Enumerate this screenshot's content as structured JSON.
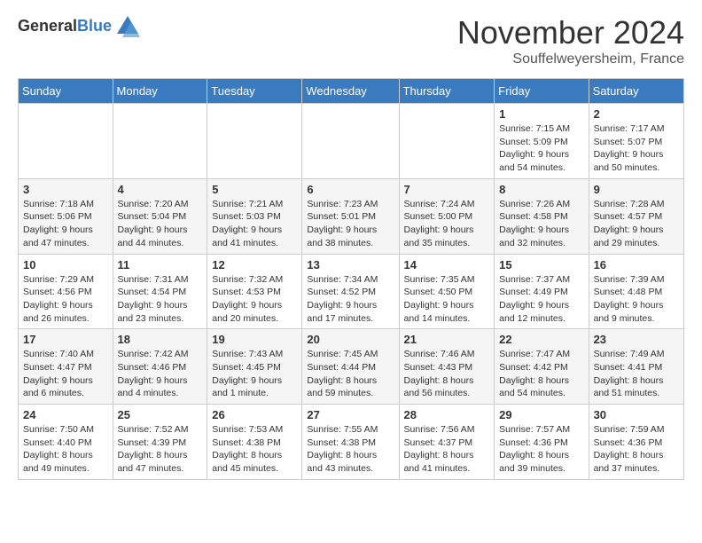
{
  "header": {
    "logo_general": "General",
    "logo_blue": "Blue",
    "title": "November 2024",
    "subtitle": "Souffelweyersheim, France"
  },
  "days_of_week": [
    "Sunday",
    "Monday",
    "Tuesday",
    "Wednesday",
    "Thursday",
    "Friday",
    "Saturday"
  ],
  "weeks": [
    [
      {
        "day": "",
        "info": ""
      },
      {
        "day": "",
        "info": ""
      },
      {
        "day": "",
        "info": ""
      },
      {
        "day": "",
        "info": ""
      },
      {
        "day": "",
        "info": ""
      },
      {
        "day": "1",
        "info": "Sunrise: 7:15 AM\nSunset: 5:09 PM\nDaylight: 9 hours and 54 minutes."
      },
      {
        "day": "2",
        "info": "Sunrise: 7:17 AM\nSunset: 5:07 PM\nDaylight: 9 hours and 50 minutes."
      }
    ],
    [
      {
        "day": "3",
        "info": "Sunrise: 7:18 AM\nSunset: 5:06 PM\nDaylight: 9 hours and 47 minutes."
      },
      {
        "day": "4",
        "info": "Sunrise: 7:20 AM\nSunset: 5:04 PM\nDaylight: 9 hours and 44 minutes."
      },
      {
        "day": "5",
        "info": "Sunrise: 7:21 AM\nSunset: 5:03 PM\nDaylight: 9 hours and 41 minutes."
      },
      {
        "day": "6",
        "info": "Sunrise: 7:23 AM\nSunset: 5:01 PM\nDaylight: 9 hours and 38 minutes."
      },
      {
        "day": "7",
        "info": "Sunrise: 7:24 AM\nSunset: 5:00 PM\nDaylight: 9 hours and 35 minutes."
      },
      {
        "day": "8",
        "info": "Sunrise: 7:26 AM\nSunset: 4:58 PM\nDaylight: 9 hours and 32 minutes."
      },
      {
        "day": "9",
        "info": "Sunrise: 7:28 AM\nSunset: 4:57 PM\nDaylight: 9 hours and 29 minutes."
      }
    ],
    [
      {
        "day": "10",
        "info": "Sunrise: 7:29 AM\nSunset: 4:56 PM\nDaylight: 9 hours and 26 minutes."
      },
      {
        "day": "11",
        "info": "Sunrise: 7:31 AM\nSunset: 4:54 PM\nDaylight: 9 hours and 23 minutes."
      },
      {
        "day": "12",
        "info": "Sunrise: 7:32 AM\nSunset: 4:53 PM\nDaylight: 9 hours and 20 minutes."
      },
      {
        "day": "13",
        "info": "Sunrise: 7:34 AM\nSunset: 4:52 PM\nDaylight: 9 hours and 17 minutes."
      },
      {
        "day": "14",
        "info": "Sunrise: 7:35 AM\nSunset: 4:50 PM\nDaylight: 9 hours and 14 minutes."
      },
      {
        "day": "15",
        "info": "Sunrise: 7:37 AM\nSunset: 4:49 PM\nDaylight: 9 hours and 12 minutes."
      },
      {
        "day": "16",
        "info": "Sunrise: 7:39 AM\nSunset: 4:48 PM\nDaylight: 9 hours and 9 minutes."
      }
    ],
    [
      {
        "day": "17",
        "info": "Sunrise: 7:40 AM\nSunset: 4:47 PM\nDaylight: 9 hours and 6 minutes."
      },
      {
        "day": "18",
        "info": "Sunrise: 7:42 AM\nSunset: 4:46 PM\nDaylight: 9 hours and 4 minutes."
      },
      {
        "day": "19",
        "info": "Sunrise: 7:43 AM\nSunset: 4:45 PM\nDaylight: 9 hours and 1 minute."
      },
      {
        "day": "20",
        "info": "Sunrise: 7:45 AM\nSunset: 4:44 PM\nDaylight: 8 hours and 59 minutes."
      },
      {
        "day": "21",
        "info": "Sunrise: 7:46 AM\nSunset: 4:43 PM\nDaylight: 8 hours and 56 minutes."
      },
      {
        "day": "22",
        "info": "Sunrise: 7:47 AM\nSunset: 4:42 PM\nDaylight: 8 hours and 54 minutes."
      },
      {
        "day": "23",
        "info": "Sunrise: 7:49 AM\nSunset: 4:41 PM\nDaylight: 8 hours and 51 minutes."
      }
    ],
    [
      {
        "day": "24",
        "info": "Sunrise: 7:50 AM\nSunset: 4:40 PM\nDaylight: 8 hours and 49 minutes."
      },
      {
        "day": "25",
        "info": "Sunrise: 7:52 AM\nSunset: 4:39 PM\nDaylight: 8 hours and 47 minutes."
      },
      {
        "day": "26",
        "info": "Sunrise: 7:53 AM\nSunset: 4:38 PM\nDaylight: 8 hours and 45 minutes."
      },
      {
        "day": "27",
        "info": "Sunrise: 7:55 AM\nSunset: 4:38 PM\nDaylight: 8 hours and 43 minutes."
      },
      {
        "day": "28",
        "info": "Sunrise: 7:56 AM\nSunset: 4:37 PM\nDaylight: 8 hours and 41 minutes."
      },
      {
        "day": "29",
        "info": "Sunrise: 7:57 AM\nSunset: 4:36 PM\nDaylight: 8 hours and 39 minutes."
      },
      {
        "day": "30",
        "info": "Sunrise: 7:59 AM\nSunset: 4:36 PM\nDaylight: 8 hours and 37 minutes."
      }
    ]
  ]
}
